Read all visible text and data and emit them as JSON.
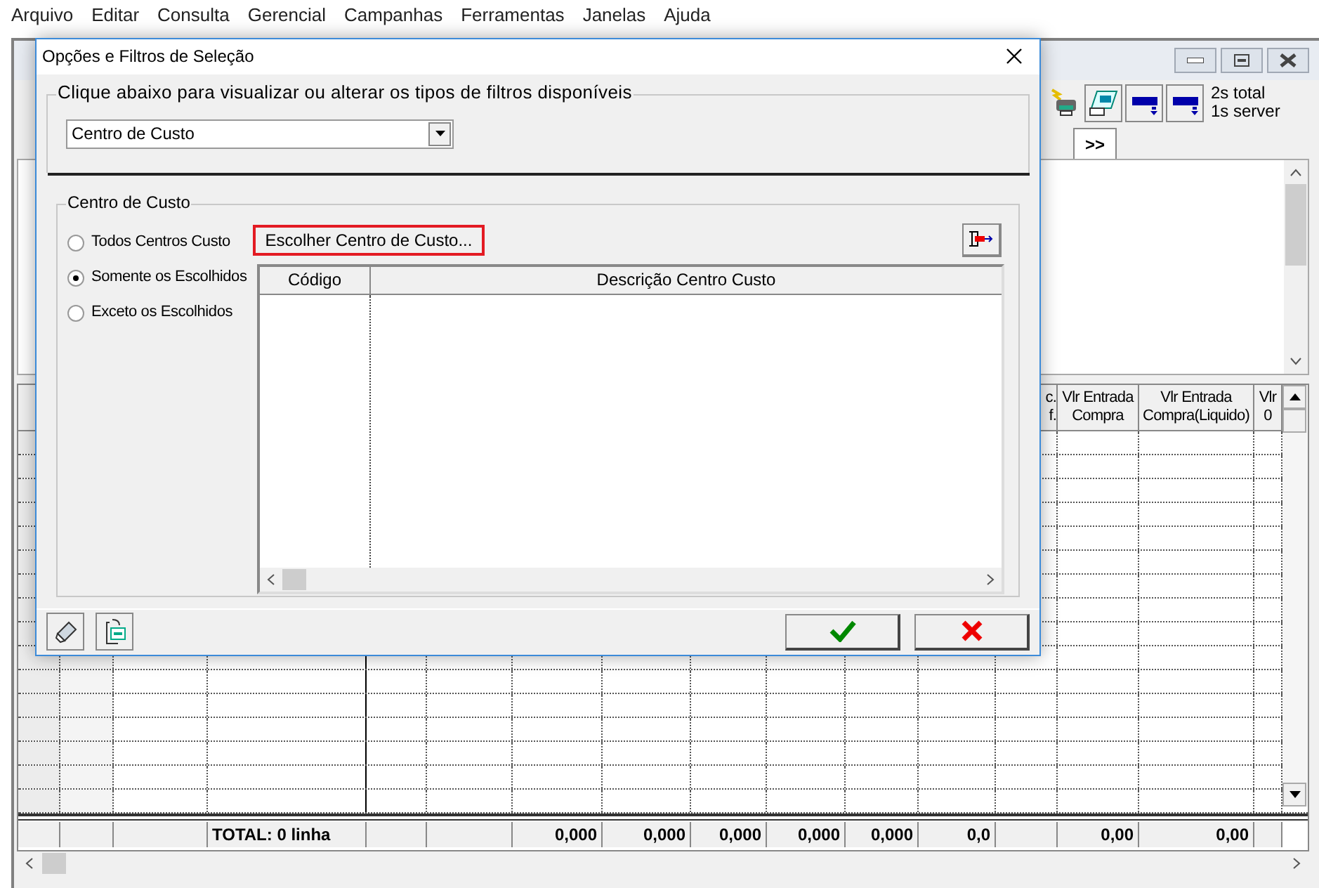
{
  "menu_bar": [
    {
      "label": "Arquivo"
    },
    {
      "label": "Editar"
    },
    {
      "label": "Consulta"
    },
    {
      "label": "Gerencial"
    },
    {
      "label": "Campanhas"
    },
    {
      "label": "Ferramentas"
    },
    {
      "label": "Janelas"
    },
    {
      "label": "Ajuda"
    }
  ],
  "background_window": {
    "timing": [
      "2s total",
      "1s server"
    ],
    "more_button": ">>",
    "grid": {
      "columns": [
        {
          "lines": [
            "c.",
            "f."
          ]
        },
        {
          "lines": [
            "Vlr Entrada",
            "Compra"
          ]
        },
        {
          "lines": [
            "Vlr Entrada",
            "Compra(Liquido)"
          ]
        },
        {
          "lines": [
            "Vlr",
            "0"
          ]
        }
      ],
      "totals": [
        "TOTAL: 0 linha",
        "0,000",
        "0,000",
        "0,000",
        "0,000",
        "0,000",
        "0,0",
        "0,00",
        "0,00"
      ]
    }
  },
  "dialog": {
    "title": "Opções e Filtros de Seleção",
    "group_label": "Clique abaixo para visualizar ou alterar os tipos de filtros disponíveis",
    "filter_type": "Centro de Custo",
    "filter": {
      "label": "Centro de Custo",
      "options": [
        {
          "label": "Todos Centros Custo",
          "selected": false
        },
        {
          "label": "Somente os Escolhidos",
          "selected": true
        },
        {
          "label": "Exceto os Escolhidos",
          "selected": false
        }
      ],
      "choose_button": {
        "label": "Escolher Centro de Custo...",
        "highlighted": true
      },
      "table": {
        "columns": [
          "Código",
          "Descrição Centro Custo"
        ]
      }
    }
  }
}
